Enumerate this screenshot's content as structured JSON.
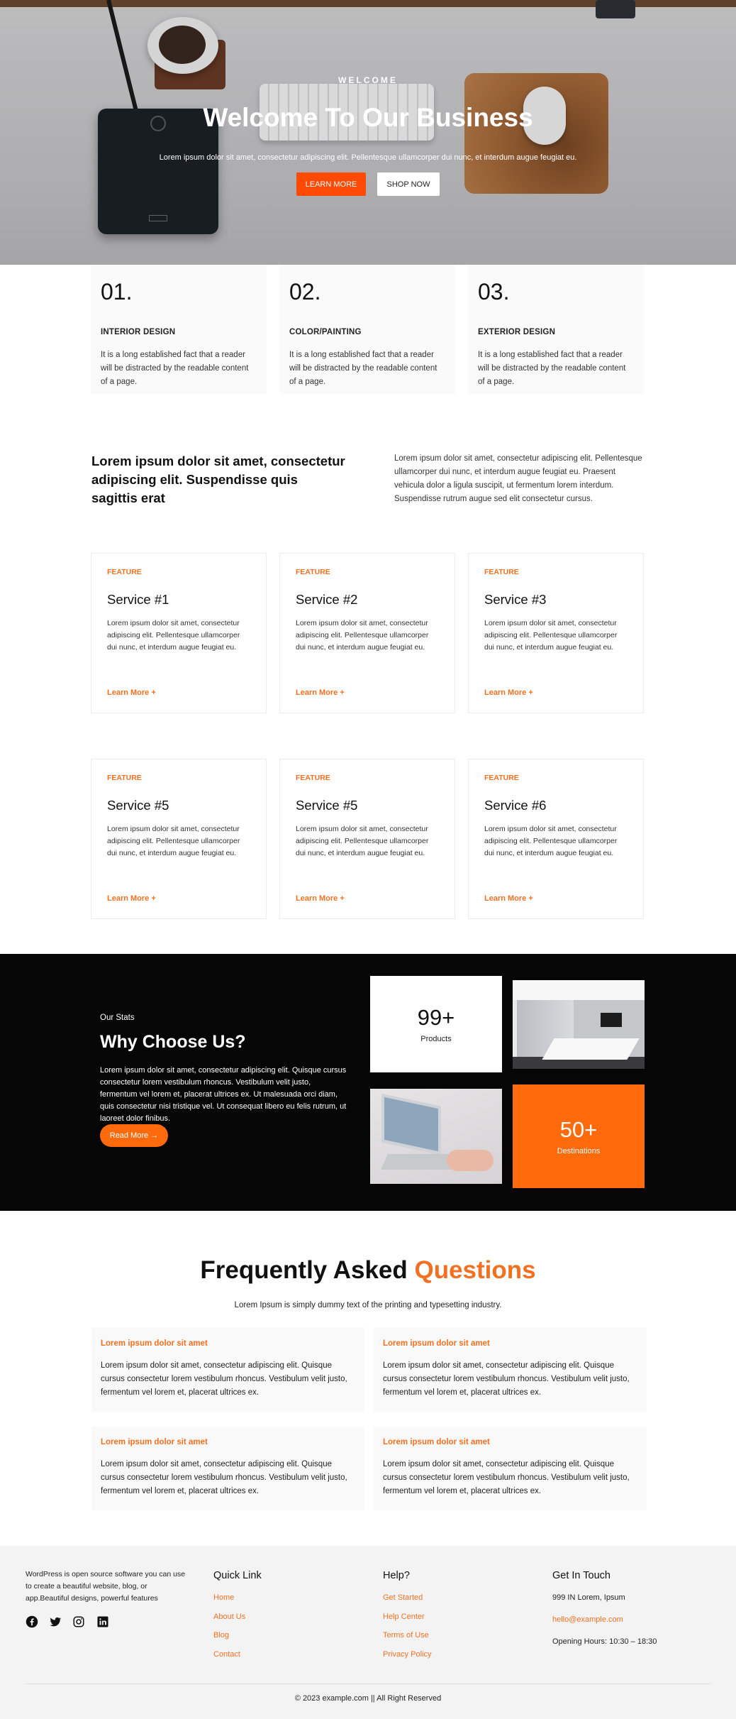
{
  "hero": {
    "eyebrow": "WELCOME",
    "title": "Welcome To Our Business",
    "subtitle": "Lorem ipsum dolor sit amet, consectetur adipiscing elit. Pellentesque ullamcorper dui nunc, et interdum augue feugiat eu.",
    "learn_more": "LEARN MORE",
    "shop_now": "SHOP NOW",
    "accent": "#ff4a06"
  },
  "features": [
    {
      "num": "01.",
      "title": "INTERIOR DESIGN",
      "desc": "It is a long established fact that a reader will be distracted by the readable content of a page."
    },
    {
      "num": "02.",
      "title": "COLOR/PAINTING",
      "desc": "It is a long established fact that a reader will be distracted by the readable content of a page."
    },
    {
      "num": "03.",
      "title": "EXTERIOR DESIGN",
      "desc": "It is a long established fact that a reader will be distracted by the readable content of a page."
    }
  ],
  "intro": {
    "heading": "Lorem ipsum dolor sit amet, consectetur adipiscing elit. Suspendisse quis sagittis erat",
    "text": "Lorem ipsum dolor sit amet, consectetur adipiscing elit. Pellentesque ullamcorper dui nunc, et interdum augue feugiat eu. Praesent vehicula dolor a ligula suscipit, ut fermentum lorem interdum. Suspendisse rutrum augue sed elit consectetur cursus."
  },
  "services": [
    {
      "tag": "FEATURE",
      "name": "Service #1",
      "text": "Lorem ipsum dolor sit amet, consectetur adipiscing elit. Pellentesque ullamcorper dui nunc, et interdum augue feugiat eu.",
      "more": "Learn More +"
    },
    {
      "tag": "FEATURE",
      "name": "Service #2",
      "text": "Lorem ipsum dolor sit amet, consectetur adipiscing elit. Pellentesque ullamcorper dui nunc, et interdum augue feugiat eu.",
      "more": "Learn More +"
    },
    {
      "tag": "FEATURE",
      "name": "Service #3",
      "text": "Lorem ipsum dolor sit amet, consectetur adipiscing elit. Pellentesque ullamcorper dui nunc, et interdum augue feugiat eu.",
      "more": "Learn More +"
    },
    {
      "tag": "FEATURE",
      "name": "Service #5",
      "text": "Lorem ipsum dolor sit amet, consectetur adipiscing elit. Pellentesque ullamcorper dui nunc, et interdum augue feugiat eu.",
      "more": "Learn More +"
    },
    {
      "tag": "FEATURE",
      "name": "Service #5",
      "text": "Lorem ipsum dolor sit amet, consectetur adipiscing elit. Pellentesque ullamcorper dui nunc, et interdum augue feugiat eu.",
      "more": "Learn More +"
    },
    {
      "tag": "FEATURE",
      "name": "Service #6",
      "text": "Lorem ipsum dolor sit amet, consectetur adipiscing elit. Pellentesque ullamcorper dui nunc, et interdum augue feugiat eu.",
      "more": "Learn More +"
    }
  ],
  "stats": {
    "eyebrow": "Our Stats",
    "title": "Why Choose Us?",
    "text": "Lorem ipsum dolor sit amet, consectetur adipiscing elit. Quisque cursus consectetur lorem vestibulum rhoncus. Vestibulum velit justo, fermentum vel lorem et, placerat ultrices ex. Ut malesuada orci diam, quis consectetur nisi tristique vel. Ut consequat libero eu felis rutrum, ut laoreet dolor finibus.",
    "button": "Read More →",
    "products_value": "99+",
    "products_label": "Products",
    "destinations_value": "50+",
    "destinations_label": "Destinations",
    "accent": "#ff6a0d"
  },
  "faq": {
    "title_main": "Frequently Asked ",
    "title_highlight": "Questions",
    "subtitle": "Lorem Ipsum is simply dummy text of the printing and typesetting industry.",
    "items": [
      {
        "q": "Lorem ipsum dolor sit amet",
        "a": "Lorem ipsum dolor sit amet, consectetur adipiscing elit. Quisque cursus consectetur lorem vestibulum rhoncus. Vestibulum velit justo, fermentum vel lorem et, placerat ultrices ex."
      },
      {
        "q": "Lorem ipsum dolor sit amet",
        "a": "Lorem ipsum dolor sit amet, consectetur adipiscing elit. Quisque cursus consectetur lorem vestibulum rhoncus. Vestibulum velit justo, fermentum vel lorem et, placerat ultrices ex."
      },
      {
        "q": "Lorem ipsum dolor sit amet",
        "a": "Lorem ipsum dolor sit amet, consectetur adipiscing elit. Quisque cursus consectetur lorem vestibulum rhoncus. Vestibulum velit justo, fermentum vel lorem et, placerat ultrices ex."
      },
      {
        "q": "Lorem ipsum dolor sit amet",
        "a": "Lorem ipsum dolor sit amet, consectetur adipiscing elit. Quisque cursus consectetur lorem vestibulum rhoncus. Vestibulum velit justo, fermentum vel lorem et, placerat ultrices ex."
      }
    ]
  },
  "footer": {
    "about": "WordPress is open source software you can use to create a beautiful website, blog, or app.Beautiful designs, powerful features",
    "social_icons": [
      "facebook-icon",
      "twitter-icon",
      "instagram-icon",
      "linkedin-icon"
    ],
    "quick_link": {
      "heading": "Quick Link",
      "links": [
        "Home",
        "About Us",
        "Blog",
        "Contact"
      ]
    },
    "help": {
      "heading": "Help?",
      "links": [
        "Get Started",
        "Help Center",
        "Terms of Use",
        "Privacy Policy"
      ]
    },
    "contact": {
      "heading": "Get In Touch",
      "address": "999 IN Lorem, Ipsum",
      "email": "hello@example.com",
      "hours": "Opening Hours: 10:30 – 18:30"
    },
    "copyright": "© 2023 example.com || All Right Reserved"
  }
}
